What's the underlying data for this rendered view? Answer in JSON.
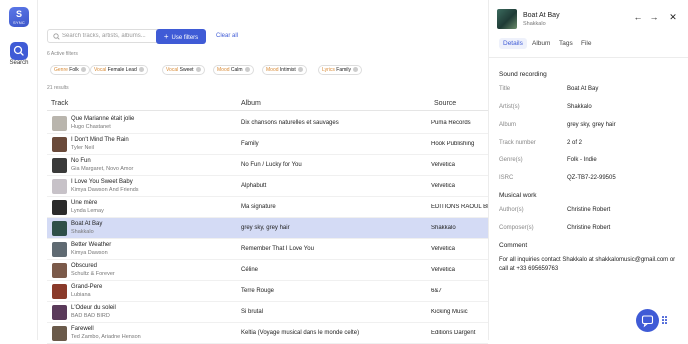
{
  "app": {
    "logo_text": "SYNC",
    "nav_search_label": "Search"
  },
  "search": {
    "placeholder": "Search tracks, artists, albums...",
    "use_filters_label": "Use filters",
    "clear_all_label": "Clear all"
  },
  "filters": {
    "active_count_label": "6 Active filters",
    "chips": [
      {
        "key": "Genre",
        "value": "Folk"
      },
      {
        "key": "Vocal",
        "value": "Female Lead"
      },
      {
        "key": "Vocal",
        "value": "Sweet"
      },
      {
        "key": "Mood",
        "value": "Calm"
      },
      {
        "key": "Mood",
        "value": "Intimist"
      },
      {
        "key": "Lyrics",
        "value": "Family"
      }
    ]
  },
  "results_label": "21 results",
  "table": {
    "headers": {
      "track": "Track",
      "album": "Album",
      "source": "Source"
    },
    "rows": [
      {
        "title": "Que Marianne était jolie",
        "artist": "Hugo Chastanet",
        "album": "Dix chansons naturelles et sauvages",
        "source": "Puma Records",
        "thumb": "#b9b5ad",
        "selected": false
      },
      {
        "title": "I Don't Mind The Rain",
        "artist": "Tyler Neil",
        "album": "Family",
        "source": "Hook Publishing",
        "thumb": "#6a4a3a",
        "selected": false
      },
      {
        "title": "No Fun",
        "artist": "Gia Margaret, Novo Amor",
        "album": "No Fun / Lucky for You",
        "source": "Velvetica",
        "thumb": "#3a3a3a",
        "selected": false
      },
      {
        "title": "I Love You Sweet Baby",
        "artist": "Kimya Dawson And Friends",
        "album": "Alphabutt",
        "source": "Velvetica",
        "thumb": "#c7c2c8",
        "selected": false
      },
      {
        "title": "Une mère",
        "artist": "Lynda Lemay",
        "album": "Ma signature",
        "source": "EDITIONS RAOUL BRETON",
        "thumb": "#2b2b2b",
        "selected": false
      },
      {
        "title": "Boat At Bay",
        "artist": "Shakkalo",
        "album": "grey sky, grey hair",
        "source": "Shakkalo",
        "thumb": "#2e4f48",
        "selected": true
      },
      {
        "title": "Better Weather",
        "artist": "Kimya Dawson",
        "album": "Remember That I Love You",
        "source": "Velvetica",
        "thumb": "#5f6a72",
        "selected": false
      },
      {
        "title": "Obscured",
        "artist": "Schultz & Forever",
        "album": "Céline",
        "source": "Velvetica",
        "thumb": "#7b5a4a",
        "selected": false
      },
      {
        "title": "Grand-Pere",
        "artist": "Lubiana",
        "album": "Terre Rouge",
        "source": "6&7",
        "thumb": "#8a3a2a",
        "selected": false
      },
      {
        "title": "L'Odeur du soleil",
        "artist": "BAD BAD BIRD",
        "album": "Si brutal",
        "source": "Kicking Music",
        "thumb": "#5a3a5a",
        "selected": false
      },
      {
        "title": "Farewell",
        "artist": "Ted Zambo, Ariadne Henson",
        "album": "Keltia (Voyage musical dans le monde celte)",
        "source": "Editions Dargent",
        "thumb": "#6a5a4a",
        "selected": false
      }
    ]
  },
  "panel": {
    "title": "Boat At Bay",
    "artist": "Shakkalo",
    "tabs": [
      "Details",
      "Album",
      "Tags",
      "File"
    ],
    "active_tab": "Details",
    "sound_recording_heading": "Sound recording",
    "fields": [
      {
        "label": "Title",
        "value": "Boat At Bay"
      },
      {
        "label": "Artist(s)",
        "value": "Shakkalo"
      },
      {
        "label": "Album",
        "value": "grey sky, grey hair"
      },
      {
        "label": "Track number",
        "value": "2 of 2"
      },
      {
        "label": "Genre(s)",
        "value": "Folk - Indie"
      },
      {
        "label": "ISRC",
        "value": "QZ-TB7-22-99505"
      }
    ],
    "musical_work_heading": "Musical work",
    "work_fields": [
      {
        "label": "Author(s)",
        "value": "Christine Robert"
      },
      {
        "label": "Composer(s)",
        "value": "Christine Robert"
      }
    ],
    "comment_heading": "Comment",
    "comment_text": "For all inquiries contact Shakkalo at shakkalomusic@gmail.com or call at +33 695659763"
  },
  "colors": {
    "accent": "#3f5bd6",
    "selected_row": "#d4dbf5",
    "filter_key": "#d88a35"
  }
}
